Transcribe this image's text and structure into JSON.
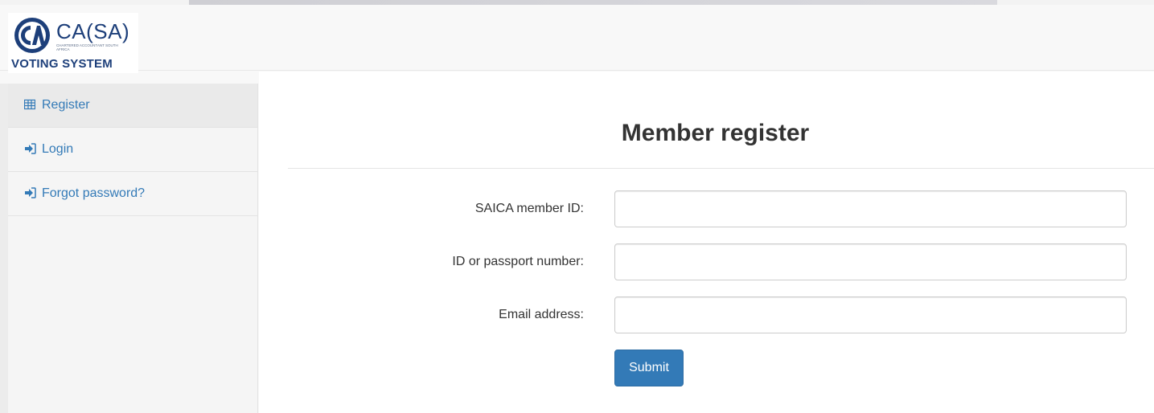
{
  "brand": {
    "name": "CA(SA)",
    "tagline": "CHARTERED ACCOUNTANT SOUTH AFRICA",
    "system": "VOTING SYSTEM",
    "color": "#1d3f7a"
  },
  "sidebar": {
    "items": [
      {
        "label": "Register",
        "icon": "table-icon",
        "active": true
      },
      {
        "label": "Login",
        "icon": "login-icon",
        "active": false
      },
      {
        "label": "Forgot password?",
        "icon": "login-icon",
        "active": false
      }
    ]
  },
  "main": {
    "title": "Member register",
    "fields": [
      {
        "label": "SAICA member ID:",
        "value": "",
        "placeholder": ""
      },
      {
        "label": "ID or passport number:",
        "value": "",
        "placeholder": ""
      },
      {
        "label": "Email address:",
        "value": "",
        "placeholder": ""
      }
    ],
    "submit_label": "Submit"
  },
  "colors": {
    "link": "#337ab7",
    "button": "#337ab7"
  }
}
